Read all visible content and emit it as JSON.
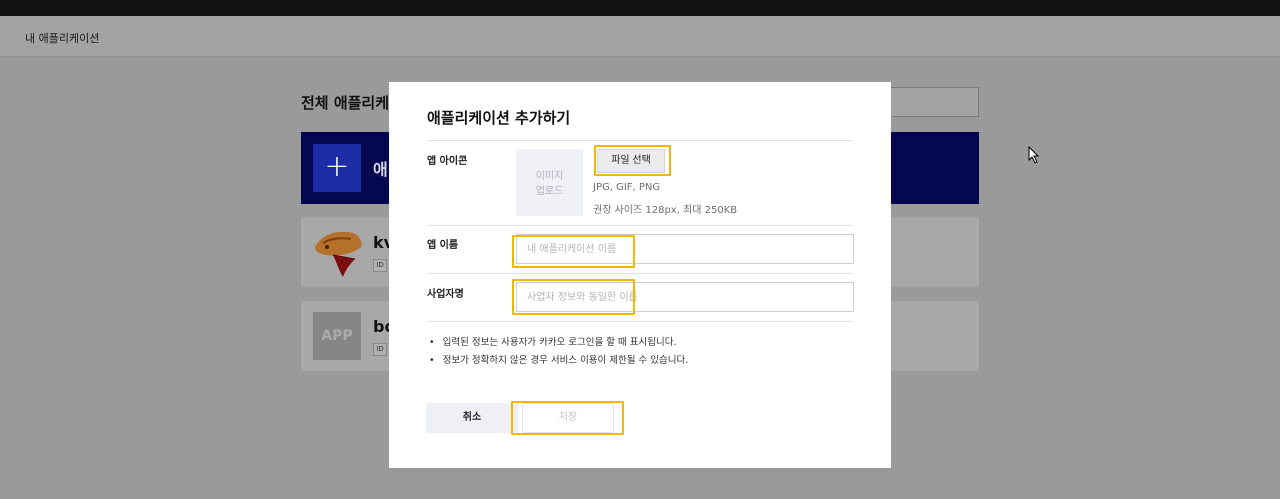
{
  "breadcrumb": "내 애플리케이션",
  "background": {
    "list_title": "전체 애플리케이",
    "add_card_label": "애",
    "apps": [
      {
        "name": "kv",
        "id_tag": "ID"
      },
      {
        "name": "bo",
        "id_tag": "ID",
        "thumb_text": "APP"
      }
    ]
  },
  "modal": {
    "title": "애플리케이션 추가하기",
    "icon_label": "앱 아이콘",
    "upload_text_line1": "이미지",
    "upload_text_line2": "업로드",
    "file_button": "파일 선택",
    "formats": "JPG, GIF, PNG",
    "size_hint": "권장 사이즈 128px, 최대 250KB",
    "name_label": "앱 이름",
    "name_placeholder": "내 애플리케이션 이름",
    "company_label": "사업자명",
    "company_placeholder": "사업자 정보와 동일한 이름",
    "notes": [
      "입력된 정보는 사용자가 카카오 로그인을 할 때 표시됩니다.",
      "정보가 정확하지 않은 경우 서비스 이용이 제한될 수 있습니다."
    ],
    "bullet": "•",
    "cancel_button": "취소",
    "save_button": "저장"
  },
  "colors": {
    "highlight": "#f2b705",
    "add_card": "#05084f",
    "overlay": "#9a9a9a"
  }
}
